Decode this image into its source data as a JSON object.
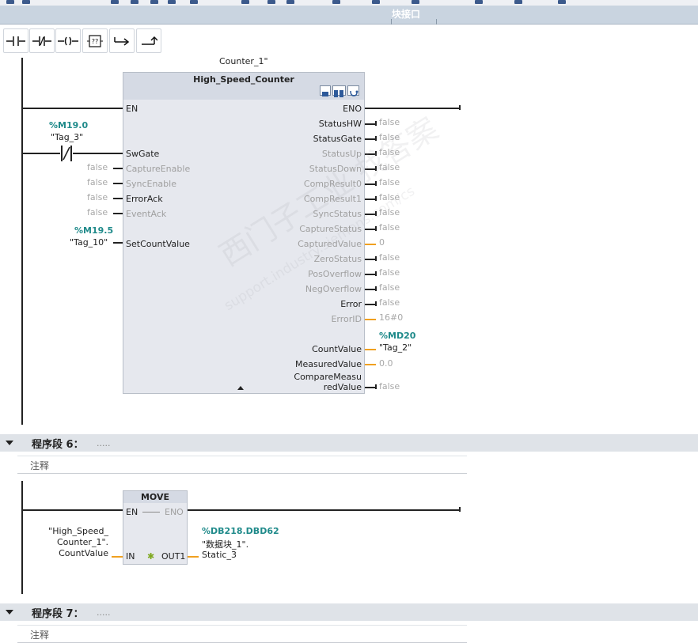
{
  "window": {
    "block_interface_label": "块接口"
  },
  "watermark": {
    "text": "西门子工业 找答案",
    "url": "support.industry.siemens.com/cs"
  },
  "segment5": {
    "instance": "Counter_1\"",
    "block": {
      "title": "High_Speed_Counter",
      "inputs": [
        {
          "name": "EN",
          "state": "active",
          "value": ""
        },
        {
          "name": "SwGate",
          "state": "active",
          "value": ""
        },
        {
          "name": "CaptureEnable",
          "state": "grey",
          "value": "false"
        },
        {
          "name": "SyncEnable",
          "state": "grey",
          "value": "false"
        },
        {
          "name": "ErrorAck",
          "state": "active",
          "value": "false"
        },
        {
          "name": "EventAck",
          "state": "grey",
          "value": "false"
        },
        {
          "name": "SetCountValue",
          "state": "active",
          "value": ""
        }
      ],
      "outputs": [
        {
          "name": "ENO",
          "state": "active",
          "value": "",
          "wire": "bool"
        },
        {
          "name": "StatusHW",
          "state": "active",
          "value": "false",
          "wire": "bool"
        },
        {
          "name": "StatusGate",
          "state": "active",
          "value": "false",
          "wire": "bool"
        },
        {
          "name": "StatusUp",
          "state": "grey",
          "value": "false",
          "wire": "bool"
        },
        {
          "name": "StatusDown",
          "state": "grey",
          "value": "false",
          "wire": "bool"
        },
        {
          "name": "CompResult0",
          "state": "grey",
          "value": "false",
          "wire": "bool"
        },
        {
          "name": "CompResult1",
          "state": "grey",
          "value": "false",
          "wire": "bool"
        },
        {
          "name": "SyncStatus",
          "state": "grey",
          "value": "false",
          "wire": "bool"
        },
        {
          "name": "CaptureStatus",
          "state": "grey",
          "value": "false",
          "wire": "bool"
        },
        {
          "name": "CapturedValue",
          "state": "grey",
          "value": "0",
          "wire": "num"
        },
        {
          "name": "ZeroStatus",
          "state": "grey",
          "value": "false",
          "wire": "bool"
        },
        {
          "name": "PosOverflow",
          "state": "grey",
          "value": "false",
          "wire": "bool"
        },
        {
          "name": "NegOverflow",
          "state": "grey",
          "value": "false",
          "wire": "bool"
        },
        {
          "name": "Error",
          "state": "active",
          "value": "false",
          "wire": "bool"
        },
        {
          "name": "ErrorID",
          "state": "grey",
          "value": "16#0",
          "wire": "num"
        }
      ],
      "countvalue": {
        "name": "CountValue",
        "addr": "%MD20",
        "tag": "\"Tag_2\""
      },
      "measuredvalue": {
        "name": "MeasuredValue",
        "value": "0.0"
      },
      "comparemeasured": {
        "name_line1": "CompareMeasu",
        "name_line2": "redValue",
        "value": "false"
      }
    },
    "contact": {
      "addr": "%M19.0",
      "tag": "\"Tag_3\""
    },
    "setcount": {
      "addr": "%M19.5",
      "tag": "\"Tag_10\""
    }
  },
  "segment6": {
    "title": "程序段 6：",
    "dots": ".....",
    "comment": "注释",
    "move": {
      "title": "MOVE",
      "en": "EN",
      "eno": "ENO",
      "in": "IN",
      "out": "OUT1",
      "in_operand": [
        "\"High_Speed_",
        "Counter_1\".",
        "CountValue"
      ],
      "out_addr": "%DB218.DBD62",
      "out_operand": [
        "\"数据块_1\".",
        "Static_3"
      ]
    }
  },
  "segment7": {
    "title": "程序段 7：",
    "dots": ".....",
    "comment": "注释"
  },
  "colors": {
    "accent_teal": "#1f8a8a",
    "wire_orange": "#f0a020",
    "segment_band": "#dfe3e8"
  }
}
